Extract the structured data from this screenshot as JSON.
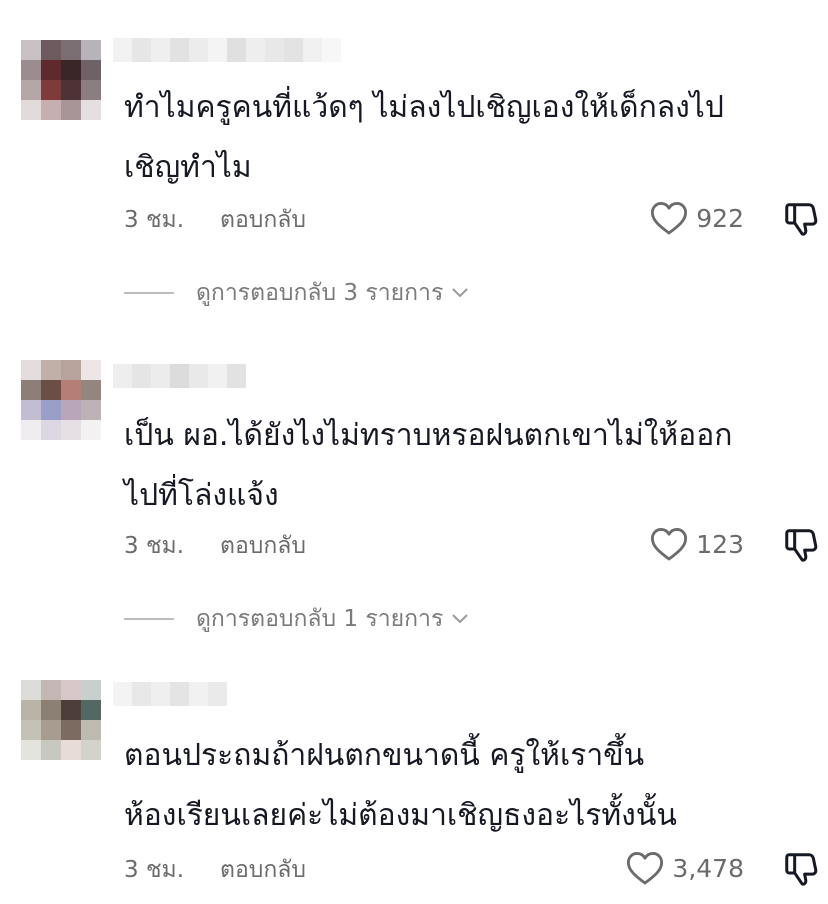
{
  "comments": [
    {
      "text_line1": "ทำไมครูคนที่แว้ดๆ ไม่ลงไปเชิญเองให้เด็กลงไป",
      "text_line2": "เชิญทำไม",
      "time": "3 ชม.",
      "reply": "ตอบกลับ",
      "likes": "922",
      "view_replies": "ดูการตอบกลับ 3 รายการ"
    },
    {
      "text_line1": "เป็น ผอ.ได้ยังไงไม่ทราบหรอฝนตกเขาไม่ให้ออก",
      "text_line2": "ไปที่โล่งแจ้ง",
      "time": "3 ชม.",
      "reply": "ตอบกลับ",
      "likes": "123",
      "view_replies": "ดูการตอบกลับ 1 รายการ"
    },
    {
      "text_line1": "ตอนประถมถ้าฝนตกขนาดนี้ ครูให้เราขึ้น",
      "text_line2": "ห้องเรียนเลยค่ะไม่ต้องมาเชิญธงอะไรทั้งนั้น",
      "time": "3 ชม.",
      "reply": "ตอบกลับ",
      "likes": "3,478"
    }
  ],
  "icons": {
    "like": "heart-outline-icon",
    "dislike": "thumbs-down-icon",
    "expand": "chevron-down-icon"
  },
  "colors": {
    "text": "#161823",
    "meta": "#6b6b6b",
    "view_replies": "#7a7a7a"
  }
}
